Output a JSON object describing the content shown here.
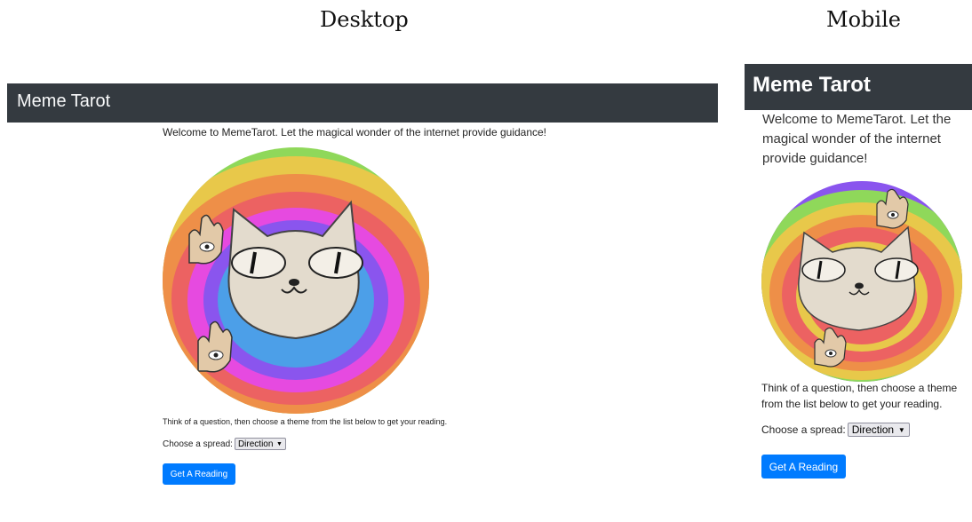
{
  "captions": {
    "desktop": "Desktop",
    "mobile": "Mobile"
  },
  "app": {
    "brand": "Meme Tarot",
    "welcome": "Welcome to MemeTarot. Let the magical wonder of the internet provide guidance!",
    "instructions": "Think of a question, then choose a theme from the list below to get your reading.",
    "spread_label": "Choose a spread:",
    "spread_selected": "Direction",
    "button_label": "Get A Reading",
    "card_image": "cat-with-eye-hands-rainbow-circle"
  },
  "colors": {
    "navbar": "#343a40",
    "button": "#007bff"
  }
}
